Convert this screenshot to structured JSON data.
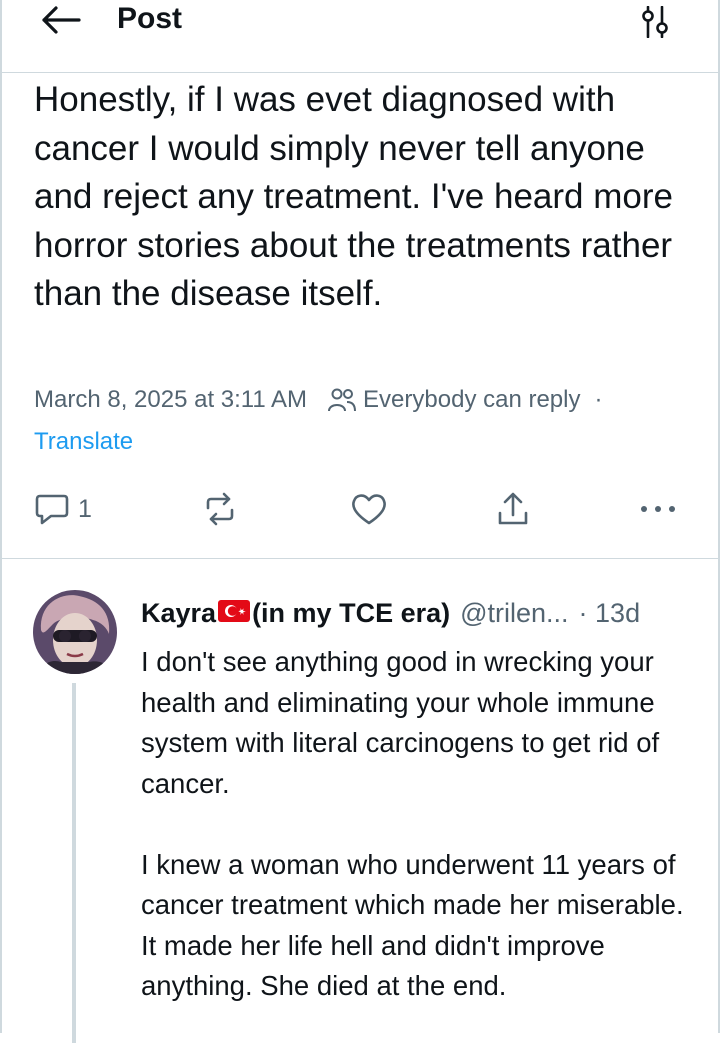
{
  "header": {
    "title": "Post",
    "back_icon": "arrow-left-icon",
    "settings_icon": "sliders-icon"
  },
  "post": {
    "text": "Honestly, if I was evet diagnosed with cancer I would simply never tell anyone and reject any treatment. I've heard more horror stories about the treatments rather than the disease itself.",
    "timestamp": "March 8, 2025 at 3:11 AM",
    "reply_setting": "Everybody can reply",
    "separator": "·",
    "translate_label": "Translate",
    "reply_count": "1",
    "actions": [
      "reply-icon",
      "repost-icon",
      "like-icon",
      "share-icon",
      "more-icon"
    ]
  },
  "reply": {
    "name": "Kayra",
    "flag": "turkey-flag",
    "name_suffix": "(in my TCE era)",
    "handle": "@trilen...",
    "time": "· 13d",
    "paragraphs": [
      "I don't see anything good in wrecking your health and eliminating your whole immune system with literal carcinogens to get rid of cancer.",
      "I knew a woman who underwent 11 years of cancer treatment which made her miserable. It made her life hell and didn't improve anything. She died at the end."
    ]
  },
  "colors": {
    "text": "#0f1419",
    "secondary": "#536471",
    "link": "#1d9bf0",
    "border": "#cfd9de"
  }
}
